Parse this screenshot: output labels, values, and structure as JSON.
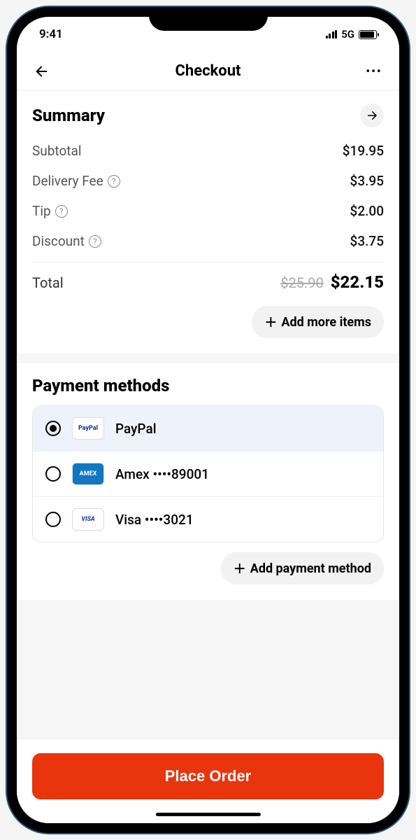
{
  "status": {
    "time": "9:41",
    "network": "5G"
  },
  "nav": {
    "title": "Checkout"
  },
  "summary": {
    "title": "Summary",
    "rows": [
      {
        "label": "Subtotal",
        "value": "$19.95",
        "help": false
      },
      {
        "label": "Delivery Fee",
        "value": "$3.95",
        "help": true
      },
      {
        "label": "Tip",
        "value": "$2.00",
        "help": true
      },
      {
        "label": "Discount",
        "value": "$3.75",
        "help": true
      }
    ],
    "total_label": "Total",
    "total_original": "$25.90",
    "total_final": "$22.15",
    "add_more": "Add more items"
  },
  "payment": {
    "title": "Payment methods",
    "methods": [
      {
        "label": "PayPal",
        "logo": "PayPal",
        "selected": true
      },
      {
        "label": "Amex ••••89001",
        "logo": "AMEX",
        "selected": false
      },
      {
        "label": "Visa ••••3021",
        "logo": "VISA",
        "selected": false
      }
    ],
    "add": "Add payment method"
  },
  "cta": {
    "place_order": "Place Order"
  }
}
